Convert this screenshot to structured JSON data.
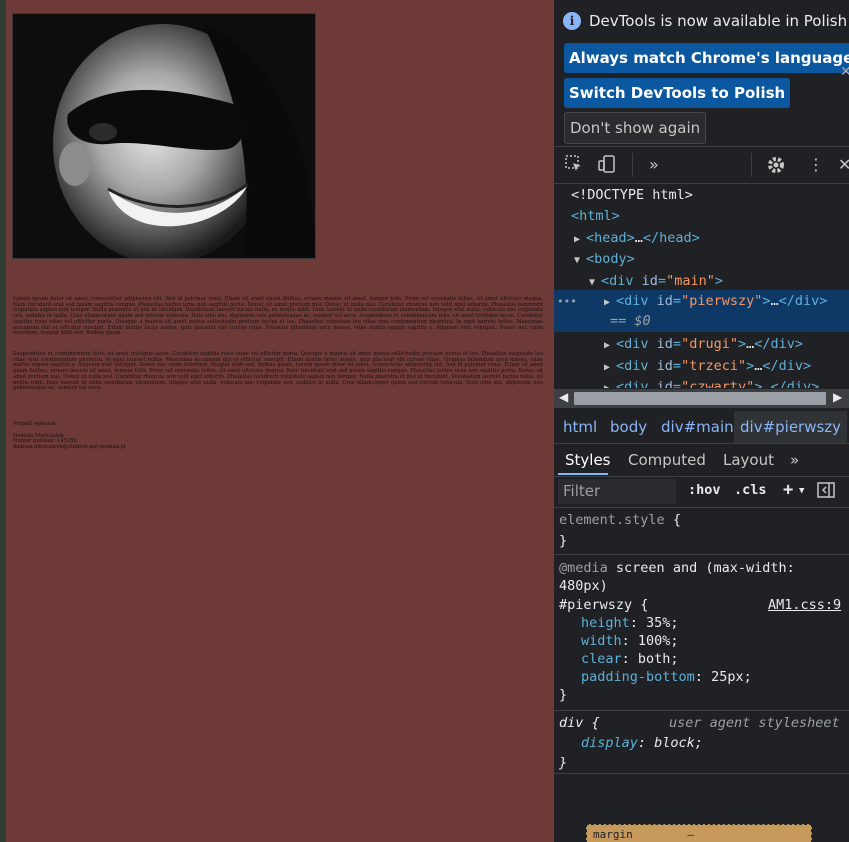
{
  "page": {
    "lorem_p1": "Lorem ipsum dolor sit amet, consectetur adipiscing elit. Sed id pulvinar risus. Etiam sit amet quam finibus, ornare mauris sit amet, tempor felis. Proin vel venenatis tellus, sit amet ultricies magna. Nam tincidunt erat sed ipsum sagittis congue. Phasellus luctus urna non sagittis porta. Donec sit amet pretium nisi. Donec ut nulla nisi. Curabitur rhoncus non velit eget lobortis. Phasellus hendrerit vulputate sapien non tempor. Nulla pharetra et nisl id tincidunt. Vestibulum laoreet luctus nulla, eu mollis nibh. Duis laoreet ut enim vestibulum elementum. Integer erat nulla, vehicula nec vulputate sed, sodales in nulla. Cras ullamcorper quam sed rutrum vehicula. Duis odio dui, dignissim non pellentesque ac, semper vel arcu. Suspendisse et condimentum felis, sit amet tristique lacus. Curabitur sagittis risus vitae vel efficitur porta. Quisque a mauris sit amet metus sollicitudin pretium luctus et leo. Phasellus vulputate leo vitae erat condimentum pharetra. In eget laoreet tellus. Maecenas accumsan dui et efficitur suscipit. Etiam mattis lacus augue, quis placerat elit cursus vitae. Vivamus bibendum arcu massa, vitae mattis sapien sagittis a. Aliquam erat volutpat. Donec nec enim interdum, feugiat nibh sed, finibus quam.",
    "lorem_p2": "Suspendisse et condimentum felis, sit amet tristique lacus. Curabitur sagittis risus vitae vel efficitur porta. Quisque a mauris sit amet metus sollicitudin pretium luctus et leo. Phasellus vulputate leo vitae erat condimentum pharetra. In eget laoreet tellus. Maecenas accumsan dui et efficitur suscipit. Etiam mattis lacus augue, quis placerat elit cursus vitae. Vivamus bibendum arcu massa, vitae mattis sapien sagittis a. Aliquam erat volutpat. Donec nec enim interdum, feugiat nibh sed, finibus quam. Lorem ipsum dolor sit amet, consectetur adipiscing elit. Sed id pulvinar risus. Etiam sit amet quam finibus, ornare mauris sit amet, tempor felis. Proin vel venenatis tellus, sit amet ultricies magna. Nam tincidunt erat sed ipsum sagittis congue. Phasellus luctus urna non sagittis porta. Donec sit amet pretium nisi. Donec ut nulla nisi. Curabitur rhoncus non velit eget lobortis. Phasellus hendrerit vulputate sapien non tempor. Nulla pharetra et nisl id tincidunt. Vestibulum laoreet luctus nulla, eu mollis nibh. Duis laoreet ut enim vestibulum elementum. Integer erat nulla, vehicula nec vulputate sed, sodales in nulla. Cras ullamcorper quam sed rutrum vehicula. Duis odio dui, dignissim non pellentesque ac, semper vel arcu.",
    "credits": [
      "Projekt wykonał:",
      "Damian Mielczarek",
      "Numer indeksu: 145288",
      "damian.mielczarek@student.put.poznan.pl"
    ]
  },
  "devtools": {
    "banner": {
      "title": "DevTools is now available in Polish!",
      "btn_match": "Always match Chrome's language",
      "btn_switch": "Switch DevTools to Polish",
      "btn_dont": "Don't show again"
    },
    "elements": {
      "doctype": "<!DOCTYPE html>",
      "html_open": "<html>",
      "head": "<head>",
      "head_close": "</head>",
      "head_ellipsis": "…",
      "body_open": "<body>",
      "div_main_attr": "id",
      "div_main_val": "\"main\"",
      "div_main_close": ">",
      "div_open": "<div",
      "div_close": "</div>",
      "ellipsis": "…",
      "pierwszy": "\"pierwszy\"",
      "drugi": "\"drugi\"",
      "trzeci": "\"trzeci\"",
      "czwarty": "\"czwarty\"",
      "sel_marker": "== $0",
      "dots": "•••"
    },
    "breadcrumbs": [
      "html",
      "body",
      "div#main",
      "div#pierwszy"
    ],
    "tabs": [
      "Styles",
      "Computed",
      "Layout"
    ],
    "filter_placeholder": "Filter",
    "hov": ":hov",
    "cls": ".cls",
    "styles": {
      "element_style": "element.style",
      "media_kw": "@media",
      "media_query": "screen and (max-width:",
      "media_query2": "480px)",
      "selector": "#pierwszy",
      "source": "AM1.css:9",
      "props": [
        {
          "name": "height",
          "value": "35%;"
        },
        {
          "name": "width",
          "value": "100%;"
        },
        {
          "name": "clear",
          "value": "both;"
        },
        {
          "name": "padding-bottom",
          "value": "25px;"
        }
      ],
      "ua_selector": "div",
      "ua_label": "user agent stylesheet",
      "ua_prop": "display",
      "ua_value": "block;",
      "box_label": "margin",
      "box_value": "–"
    }
  }
}
